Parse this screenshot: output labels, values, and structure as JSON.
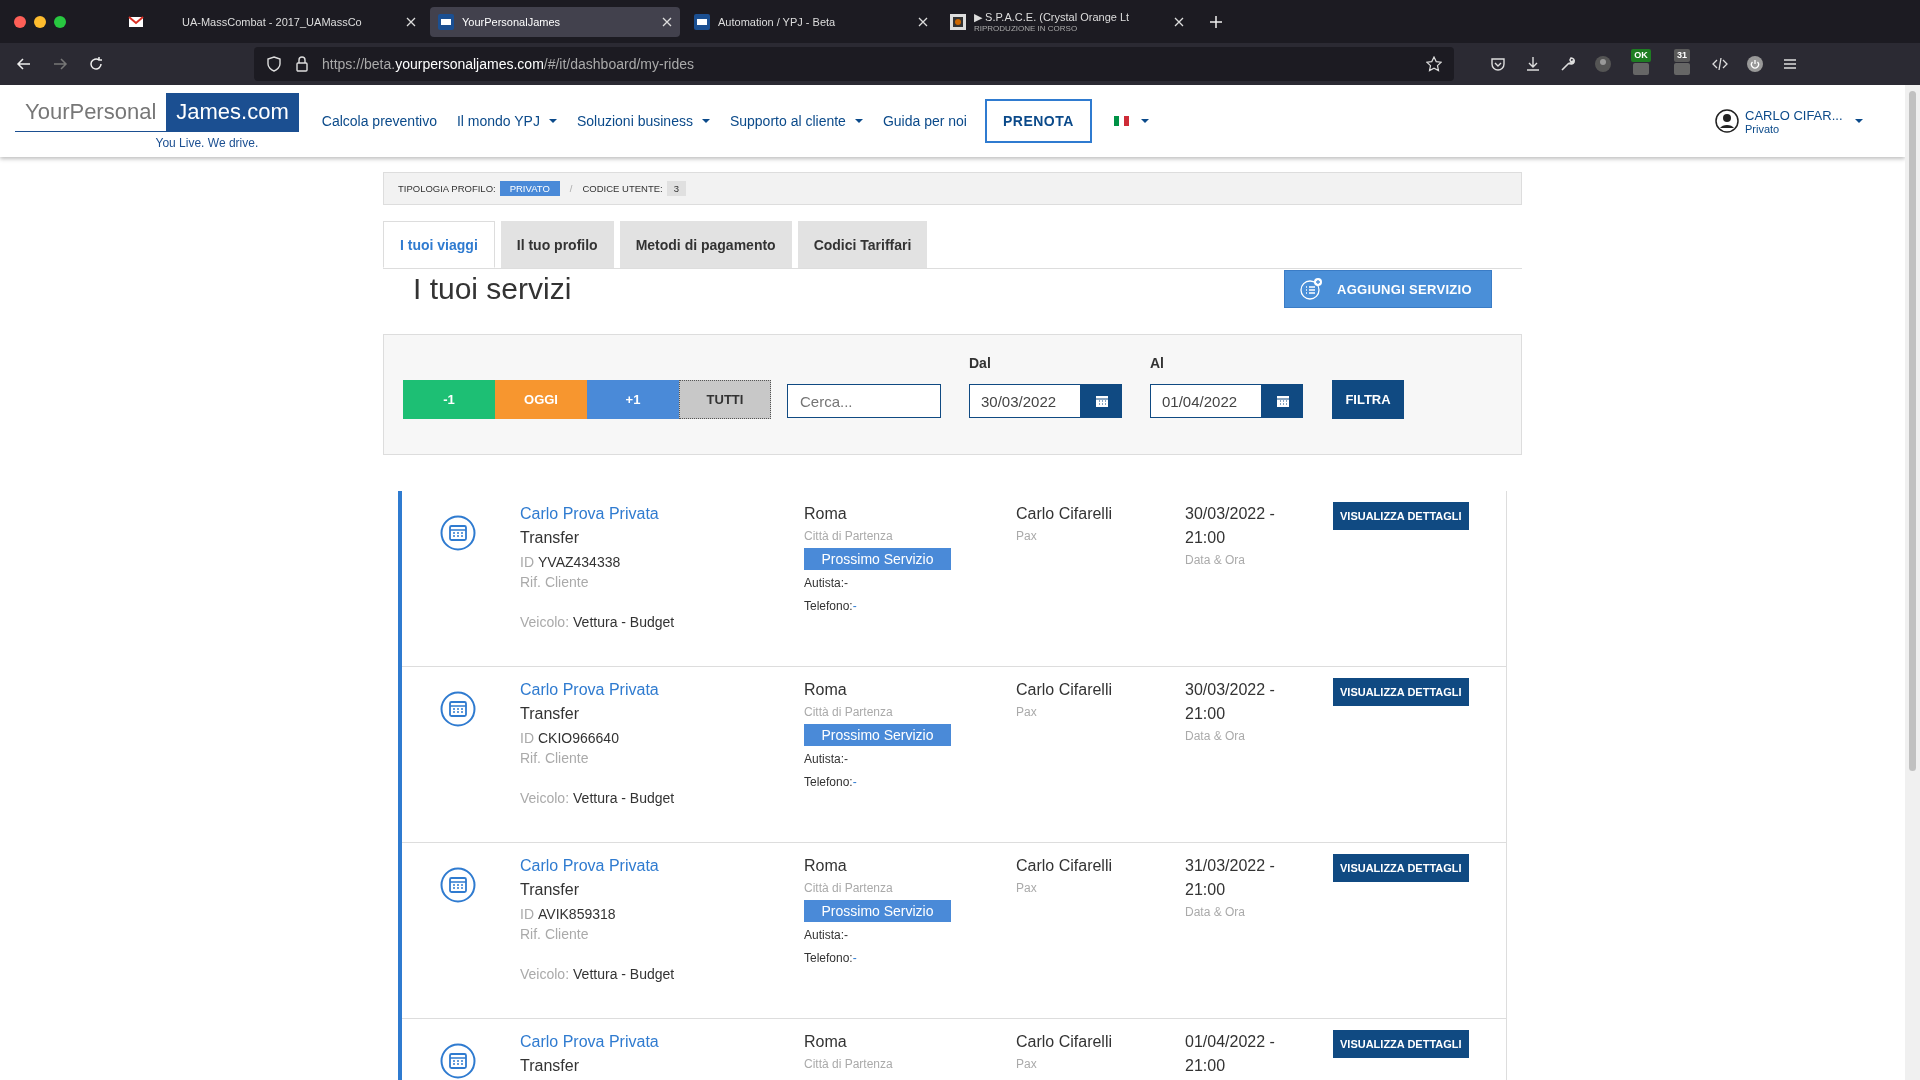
{
  "browser": {
    "tabs": [
      {
        "kind": "mail",
        "selected": false
      },
      {
        "kind": "plain",
        "title": "UA-MassCombat - 2017_UAMassCo",
        "selected": false
      },
      {
        "kind": "site",
        "title": "YourPersonalJames",
        "selected": true
      },
      {
        "kind": "site",
        "title": "Automation / YPJ - Beta",
        "selected": false
      },
      {
        "kind": "media",
        "title": "▶ S.P.A.C.E. (Crystal Orange Lt",
        "subtitle": "RIPRODUZIONE IN CORSO",
        "selected": false
      }
    ],
    "url": "https://beta.**yourpersonaljames.com**/#/it/dashboard/my-rides",
    "extension_badges": [
      {
        "text": "OK",
        "color": "#1e7d22"
      },
      {
        "text": "31",
        "color": "#5a5a5a"
      }
    ]
  },
  "header": {
    "logo": {
      "left": "YourPersonal",
      "right": "James.com",
      "tagline": "You Live. We drive."
    },
    "nav": [
      {
        "label": "Calcola preventivo",
        "dropdown": false
      },
      {
        "label": "Il mondo YPJ",
        "dropdown": true
      },
      {
        "label": "Soluzioni business",
        "dropdown": true
      },
      {
        "label": "Supporto al cliente",
        "dropdown": true
      },
      {
        "label": "Guida per noi",
        "dropdown": false
      }
    ],
    "book_button": "PRENOTA",
    "user": {
      "name": "CARLO CIFAR...",
      "role": "Privato"
    }
  },
  "profile_bar": {
    "separator": "/",
    "items": [
      {
        "label": "TIPOLOGIA PROFILO:",
        "value": "PRIVATO",
        "kind": "primary"
      },
      {
        "label": "CODICE UTENTE:",
        "value": "3",
        "kind": "plain"
      }
    ]
  },
  "tabs": [
    {
      "label": "I tuoi viaggi",
      "selected": true
    },
    {
      "label": "Il tuo profilo",
      "selected": false
    },
    {
      "label": "Metodi di pagamento",
      "selected": false
    },
    {
      "label": "Codici Tariffari",
      "selected": false
    }
  ],
  "page_title": "I tuoi servizi",
  "add_button": "AGGIUNGI SERVIZIO",
  "filter": {
    "quick": [
      {
        "label": "-1",
        "color": "#1dbf74"
      },
      {
        "label": "OGGI",
        "color": "#f7962f"
      },
      {
        "label": "+1",
        "color": "#4a8ad8"
      },
      {
        "label": "TUTTI",
        "color": "#c8c8c8"
      }
    ],
    "search": {
      "placeholder": "Cerca..."
    },
    "from": {
      "label": "Dal",
      "value": "30/03/2022"
    },
    "to": {
      "label": "Al",
      "value": "01/04/2022"
    },
    "button": "FILTRA"
  },
  "rides": [
    {
      "name": "Carlo Prova Privata",
      "service": "Transfer",
      "id_label": "ID",
      "id": "YVAZ434338",
      "ref_label": "Rif. Cliente",
      "vehicle_label": "Veicolo:",
      "vehicle": "Vettura - Budget",
      "city": "Roma",
      "city_label": "Città di Partenza",
      "status": "Prossimo Servizio",
      "driver_label": "Autista:",
      "driver": "-",
      "phone_label": "Telefono:",
      "phone": "-",
      "pax": "Carlo Cifarelli",
      "pax_label": "Pax",
      "datetime": "30/03/2022 - 21:00",
      "datetime_label": "Data & Ora",
      "button": "VISUALIZZA DETTAGLI"
    },
    {
      "name": "Carlo Prova Privata",
      "service": "Transfer",
      "id_label": "ID",
      "id": "CKIO966640",
      "ref_label": "Rif. Cliente",
      "vehicle_label": "Veicolo:",
      "vehicle": "Vettura - Budget",
      "city": "Roma",
      "city_label": "Città di Partenza",
      "status": "Prossimo Servizio",
      "driver_label": "Autista:",
      "driver": "-",
      "phone_label": "Telefono:",
      "phone": "-",
      "pax": "Carlo Cifarelli",
      "pax_label": "Pax",
      "datetime": "30/03/2022 - 21:00",
      "datetime_label": "Data & Ora",
      "button": "VISUALIZZA DETTAGLI"
    },
    {
      "name": "Carlo Prova Privata",
      "service": "Transfer",
      "id_label": "ID",
      "id": "AVIK859318",
      "ref_label": "Rif. Cliente",
      "vehicle_label": "Veicolo:",
      "vehicle": "Vettura - Budget",
      "city": "Roma",
      "city_label": "Città di Partenza",
      "status": "Prossimo Servizio",
      "driver_label": "Autista:",
      "driver": "-",
      "phone_label": "Telefono:",
      "phone": "-",
      "pax": "Carlo Cifarelli",
      "pax_label": "Pax",
      "datetime": "31/03/2022 - 21:00",
      "datetime_label": "Data & Ora",
      "button": "VISUALIZZA DETTAGLI"
    },
    {
      "name": "Carlo Prova Privata",
      "service": "Transfer",
      "city": "Roma",
      "city_label": "Città di Partenza",
      "pax": "Carlo Cifarelli",
      "pax_label": "Pax",
      "datetime": "01/04/2022 - 21:00",
      "button": "VISUALIZZA DETTAGLI"
    }
  ]
}
